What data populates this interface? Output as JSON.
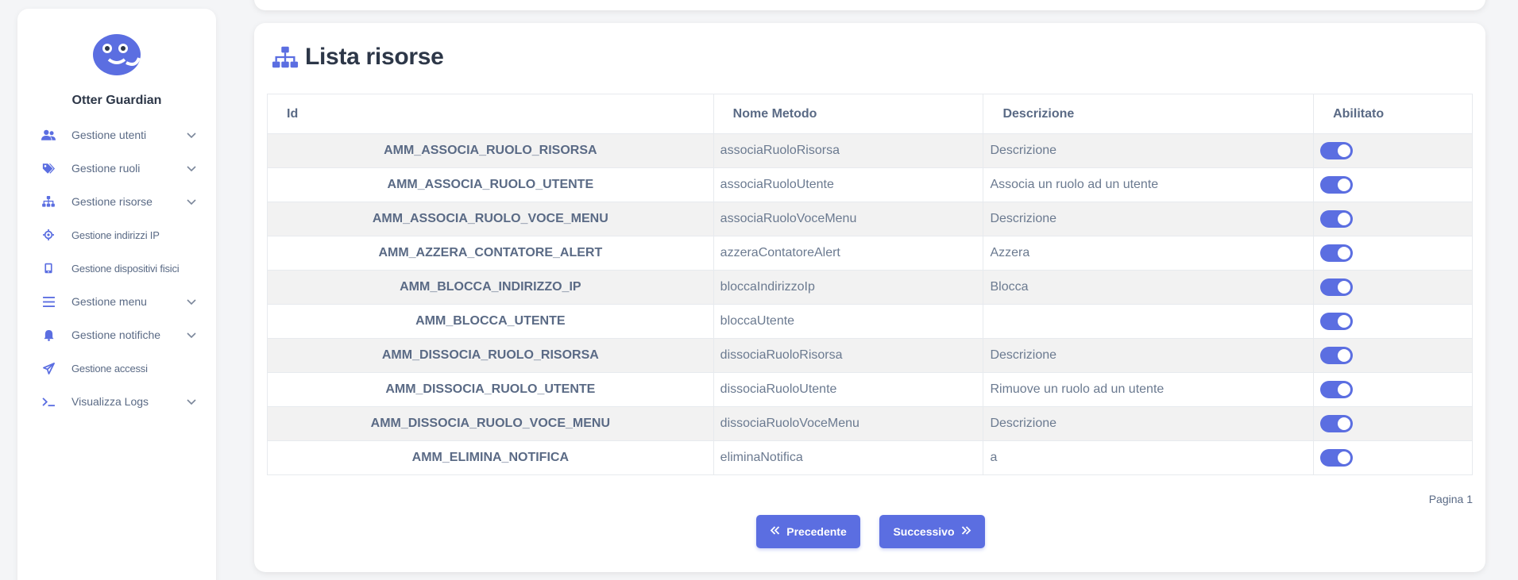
{
  "app": {
    "name": "Otter Guardian",
    "accent_color": "#5b6ee1"
  },
  "sidebar": {
    "items": [
      {
        "label": "Gestione utenti",
        "icon": "users-icon",
        "has_submenu": true
      },
      {
        "label": "Gestione ruoli",
        "icon": "tags-icon",
        "has_submenu": true
      },
      {
        "label": "Gestione risorse",
        "icon": "sitemap-icon",
        "has_submenu": true
      },
      {
        "label": "Gestione indirizzi IP",
        "icon": "crosshair-icon",
        "has_submenu": false
      },
      {
        "label": "Gestione dispositivi fisici",
        "icon": "mobile-icon",
        "has_submenu": false
      },
      {
        "label": "Gestione menu",
        "icon": "bars-icon",
        "has_submenu": true
      },
      {
        "label": "Gestione notifiche",
        "icon": "bell-icon",
        "has_submenu": true
      },
      {
        "label": "Gestione accessi",
        "icon": "send-icon",
        "has_submenu": false
      },
      {
        "label": "Visualizza Logs",
        "icon": "terminal-icon",
        "has_submenu": true
      }
    ]
  },
  "main": {
    "title": "Lista risorse",
    "title_icon": "sitemap-icon",
    "table": {
      "headers": [
        "Id",
        "Nome Metodo",
        "Descrizione",
        "Abilitato"
      ],
      "rows": [
        {
          "id": "AMM_ASSOCIA_RUOLO_RISORSA",
          "metodo": "associaRuoloRisorsa",
          "descrizione": "Descrizione",
          "abilitato": true
        },
        {
          "id": "AMM_ASSOCIA_RUOLO_UTENTE",
          "metodo": "associaRuoloUtente",
          "descrizione": "Associa un ruolo ad un utente",
          "abilitato": true
        },
        {
          "id": "AMM_ASSOCIA_RUOLO_VOCE_MENU",
          "metodo": "associaRuoloVoceMenu",
          "descrizione": "Descrizione",
          "abilitato": true
        },
        {
          "id": "AMM_AZZERA_CONTATORE_ALERT",
          "metodo": "azzeraContatoreAlert",
          "descrizione": "Azzera",
          "abilitato": true
        },
        {
          "id": "AMM_BLOCCA_INDIRIZZO_IP",
          "metodo": "bloccaIndirizzoIp",
          "descrizione": "Blocca",
          "abilitato": true
        },
        {
          "id": "AMM_BLOCCA_UTENTE",
          "metodo": "bloccaUtente",
          "descrizione": "",
          "abilitato": true
        },
        {
          "id": "AMM_DISSOCIA_RUOLO_RISORSA",
          "metodo": "dissociaRuoloRisorsa",
          "descrizione": "Descrizione",
          "abilitato": true
        },
        {
          "id": "AMM_DISSOCIA_RUOLO_UTENTE",
          "metodo": "dissociaRuoloUtente",
          "descrizione": "Rimuove un ruolo ad un utente",
          "abilitato": true
        },
        {
          "id": "AMM_DISSOCIA_RUOLO_VOCE_MENU",
          "metodo": "dissociaRuoloVoceMenu",
          "descrizione": "Descrizione",
          "abilitato": true
        },
        {
          "id": "AMM_ELIMINA_NOTIFICA",
          "metodo": "eliminaNotifica",
          "descrizione": "a",
          "abilitato": true
        }
      ]
    },
    "pagination": {
      "page_label": "Pagina 1",
      "prev_label": "Precedente",
      "next_label": "Successivo"
    }
  }
}
